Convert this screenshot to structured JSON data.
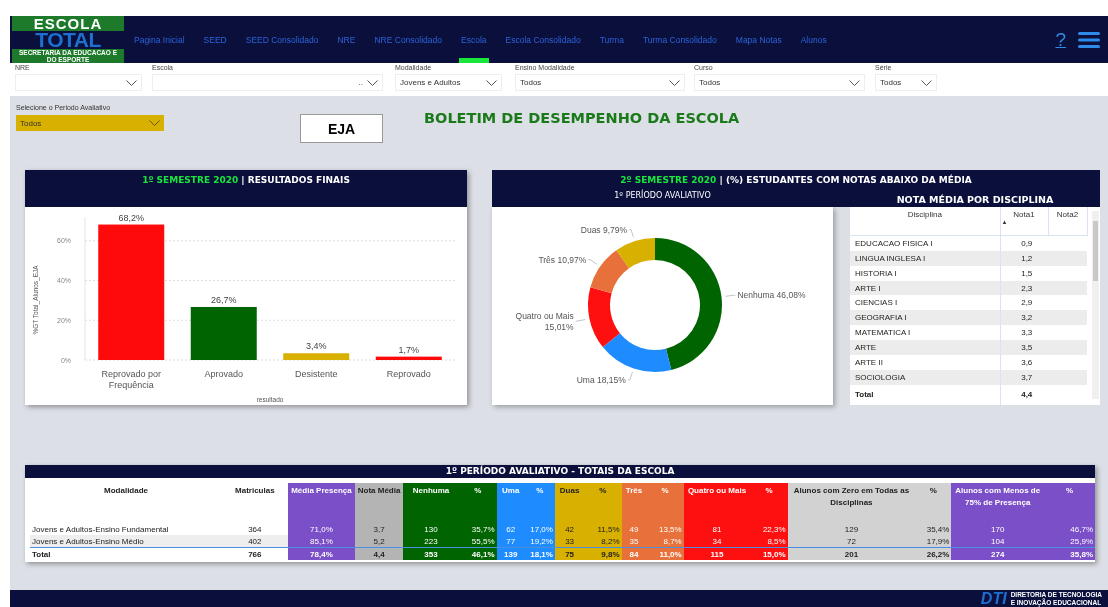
{
  "header": {
    "logo": {
      "title": "ESCOLA",
      "wordmark": "TOTAL",
      "subtitle": "SECRETARIA DA EDUCACAO E DO ESPORTE"
    },
    "nav": [
      {
        "label": "Pagina Inicial",
        "selected": false
      },
      {
        "label": "SEED",
        "selected": false
      },
      {
        "label": "SEED Consolidado",
        "selected": false
      },
      {
        "label": "NRE",
        "selected": false
      },
      {
        "label": "NRE Consolidado",
        "selected": false
      },
      {
        "label": "Escola",
        "selected": true
      },
      {
        "label": "Escola Consolidado",
        "selected": false
      },
      {
        "label": "Turma",
        "selected": false
      },
      {
        "label": "Turma Consolidado",
        "selected": false
      },
      {
        "label": "Mapa Notas",
        "selected": false
      },
      {
        "label": "Alunos",
        "selected": false
      }
    ],
    "help": "?"
  },
  "filters": [
    {
      "label": "NRE"
    },
    {
      "label": "Escola",
      "value": ".."
    },
    {
      "label": "Modalidade",
      "value": "Jovens e Adultos"
    },
    {
      "label": "Ensino Modalidade",
      "value": "Todos"
    },
    {
      "label": "Curso",
      "value": "Todos"
    },
    {
      "label": "Série",
      "value": "Todos"
    }
  ],
  "period_filter": {
    "label": "Selecione o Periodo Avaliativo",
    "value": "Todos"
  },
  "badge": "EJA",
  "title": "BOLETIM DE DESEMPENHO DA ESCOLA",
  "results_card": {
    "title_highlight": "1º SEMESTRE 2020",
    "title": "| RESULTADOS FINAIS",
    "chart_data": {
      "type": "bar",
      "xlabel": "resultado",
      "ylabel": "%GT Total_Alunos_EJA",
      "categories": [
        "Reprovado por Frequência",
        "Aprovado",
        "Desistente",
        "Reprovado"
      ],
      "values": [
        68.2,
        26.7,
        3.4,
        1.7
      ],
      "colors": [
        "#ff0a0a",
        "#006400",
        "#d8b000",
        "#ff0a0a"
      ],
      "value_labels": [
        "68,2%",
        "26,7%",
        "3,4%",
        "1,7%"
      ],
      "grid": true,
      "ylim": [
        0,
        72
      ],
      "yticks": [
        {
          "value": 0,
          "label": "0%"
        },
        {
          "value": 20,
          "label": "20%"
        },
        {
          "value": 40,
          "label": "40%"
        },
        {
          "value": 60,
          "label": "60%"
        }
      ]
    }
  },
  "below_card": {
    "title_highlight": "2º SEMESTRE 2020",
    "title": "| (%) ESTUDANTES COM NOTAS ABAIXO DA MÉDIA",
    "donut": {
      "title": "1º PERÍODO AVALIATIVO",
      "chart_data": {
        "type": "donut",
        "categories": [
          "Nenhuma",
          "Uma",
          "Quatro ou Mais",
          "Três",
          "Duas"
        ],
        "values": [
          46.08,
          18.15,
          15.01,
          10.97,
          9.79
        ],
        "colors": [
          "#006400",
          "#1e8cff",
          "#ff1010",
          "#e8703a",
          "#d8b000"
        ],
        "value_labels": [
          "46,08%",
          "18,15%",
          "15,01%",
          "10,97%",
          "9,79%"
        ]
      }
    },
    "grades": {
      "title": "NOTA MÉDIA POR DISCIPLINA",
      "columns": [
        "Disciplina",
        "Nota1",
        "Nota2"
      ],
      "sort_marker": "▲",
      "rows": [
        [
          "EDUCACAO FISICA I",
          "0,9"
        ],
        [
          "LINGUA INGLESA I",
          "1,2"
        ],
        [
          "HISTORIA I",
          "1,5"
        ],
        [
          "ARTE I",
          "2,3"
        ],
        [
          "CIENCIAS I",
          "2,9"
        ],
        [
          "GEOGRAFIA I",
          "3,2"
        ],
        [
          "MATEMATICA I",
          "3,3"
        ],
        [
          "ARTE",
          "3,5"
        ],
        [
          "ARTE II",
          "3,6"
        ],
        [
          "SOCIOLOGIA",
          "3,7"
        ]
      ],
      "total": [
        "Total",
        "4,4"
      ]
    }
  },
  "totals": {
    "title": "1º PERÍODO AVALIATIVO - TOTAIS DA ESCOLA",
    "columns": [
      {
        "label": "Modalidade",
        "color": "#ffffff"
      },
      {
        "label": "Matriculas",
        "color": "#ffffff"
      },
      {
        "label": "Média Presença",
        "color": "#7b4fc8"
      },
      {
        "label": "Nota Média",
        "color": "#b4b4b4"
      },
      {
        "label": "Nenhuma",
        "color": "#006400"
      },
      {
        "label": "%",
        "color": "#006400"
      },
      {
        "label": "Uma",
        "color": "#1e8cff"
      },
      {
        "label": "%",
        "color": "#1e8cff"
      },
      {
        "label": "Duas",
        "color": "#d8b000"
      },
      {
        "label": "%",
        "color": "#d8b000"
      },
      {
        "label": "Três",
        "color": "#e8703a"
      },
      {
        "label": "%",
        "color": "#e8703a"
      },
      {
        "label": "Quatro ou Mais",
        "color": "#ff1010"
      },
      {
        "label": "%",
        "color": "#ff1010"
      },
      {
        "label": "Alunos com Zero em Todas as Disciplinas",
        "color": "#d2d2d2"
      },
      {
        "label": "%",
        "color": "#d2d2d2"
      },
      {
        "label": "Alunos com Menos de 75% de Presença",
        "color": "#7b4fc8"
      },
      {
        "label": "%",
        "color": "#7b4fc8"
      }
    ],
    "rows": [
      [
        "Jovens e Adultos-Ensino Fundamental",
        "364",
        "71,0%",
        "3,7",
        "130",
        "35,7%",
        "62",
        "17,0%",
        "42",
        "11,5%",
        "49",
        "13,5%",
        "81",
        "22,3%",
        "129",
        "35,4%",
        "170",
        "46,7%"
      ],
      [
        "Jovens e Adultos-Ensino Médio",
        "402",
        "85,1%",
        "5,2",
        "223",
        "55,5%",
        "77",
        "19,2%",
        "33",
        "8,2%",
        "35",
        "8,7%",
        "34",
        "8,5%",
        "72",
        "17,9%",
        "104",
        "25,9%"
      ]
    ],
    "total": [
      "Total",
      "766",
      "78,4%",
      "4,4",
      "353",
      "46,1%",
      "139",
      "18,1%",
      "75",
      "9,8%",
      "84",
      "11,0%",
      "115",
      "15,0%",
      "201",
      "26,2%",
      "274",
      "35,8%"
    ]
  },
  "footer": {
    "brand": "DTI",
    "lines": [
      "DIRETORIA DE TECNOLOGIA",
      "E INOVAÇÃO EDUCACIONAL"
    ]
  }
}
